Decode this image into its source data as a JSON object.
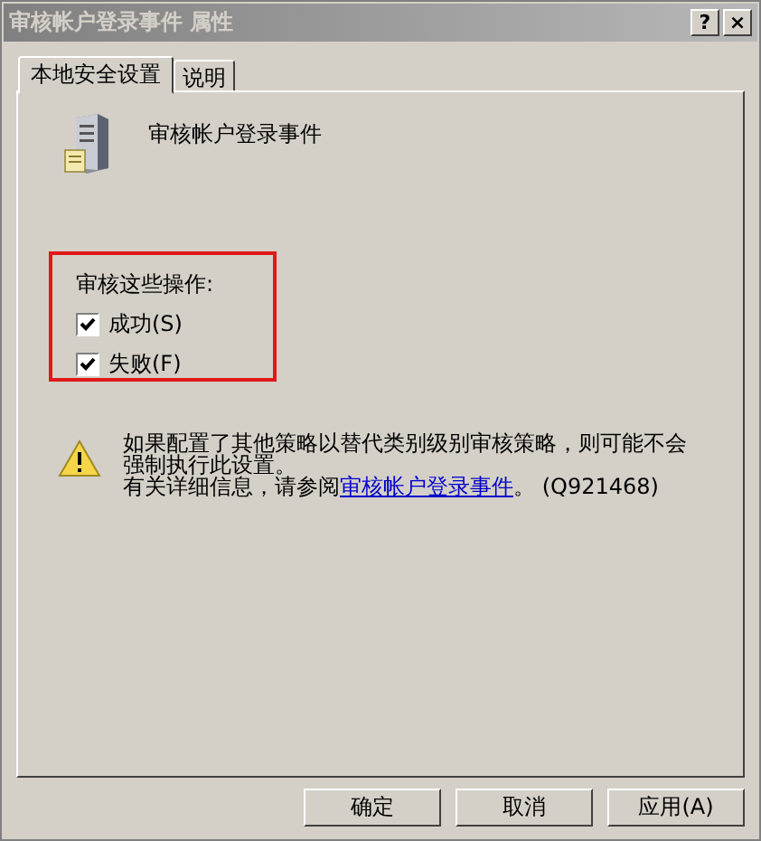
{
  "window": {
    "title": "审核帐户登录事件 属性",
    "title_buttons": [
      "?",
      "×"
    ]
  },
  "tabs": [
    {
      "label": "本地安全设置",
      "selected": true
    },
    {
      "label": "说明",
      "selected": false
    }
  ],
  "policy": {
    "name": "审核帐户登录事件"
  },
  "audit": {
    "heading": "审核这些操作:",
    "options": [
      {
        "label": "成功(S)",
        "checked": true
      },
      {
        "label": "失败(F)",
        "checked": true
      }
    ]
  },
  "warning": {
    "text": "如果配置了其他策略以替代类别级别审核策略，则可能不会强制执行此设置。",
    "info_before": "有关详细信息，请参阅",
    "info_link": "审核帐户登录事件",
    "info_after": "。 (Q921468)"
  },
  "buttons": [
    "确定",
    "取消",
    "应用(A)"
  ]
}
